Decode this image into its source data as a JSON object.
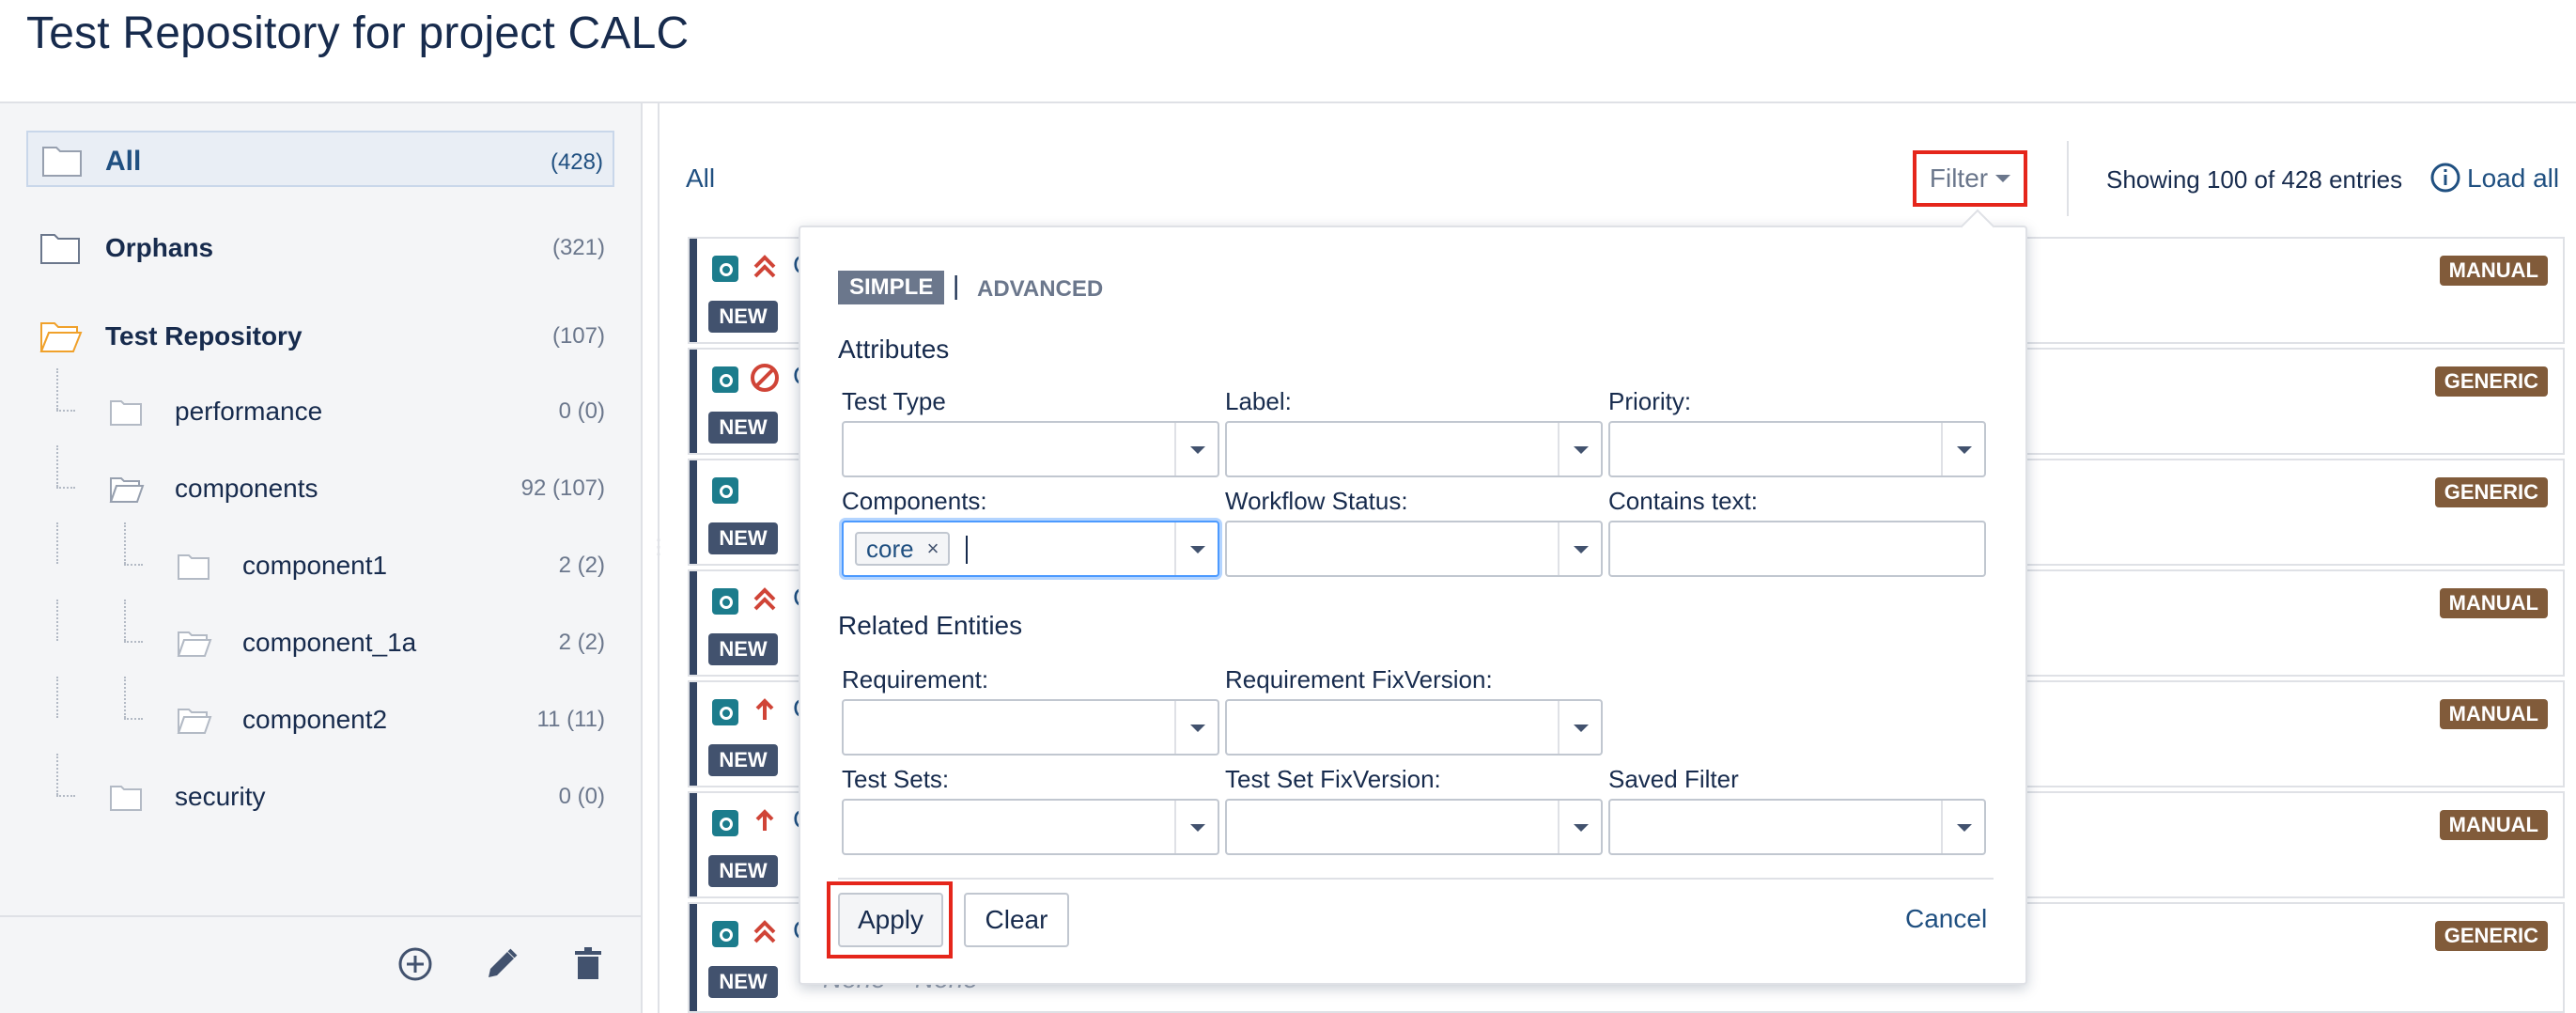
{
  "page": {
    "title": "Test Repository for project CALC"
  },
  "sidebar": {
    "all": {
      "label": "All",
      "count": "(428)"
    },
    "orphans": {
      "label": "Orphans",
      "count": "(321)"
    },
    "repo": {
      "label": "Test Repository",
      "count": "(107)"
    },
    "folders": [
      {
        "label": "performance",
        "count": "0 (0)"
      },
      {
        "label": "components",
        "count": "92 (107)"
      },
      {
        "label": "component1",
        "count": "2 (2)"
      },
      {
        "label": "component_1a",
        "count": "2 (2)"
      },
      {
        "label": "component2",
        "count": "11 (11)"
      },
      {
        "label": "security",
        "count": "0 (0)"
      }
    ],
    "tools": [
      "add-icon",
      "edit-icon",
      "delete-icon"
    ]
  },
  "main": {
    "crumb": "All",
    "filter_label": "Filter",
    "showing": "Showing 100 of 428 entries",
    "load_all": "Load all",
    "rows": [
      {
        "badge": "NEW",
        "type": "MANUAL",
        "priority": "double-chevron-up"
      },
      {
        "badge": "NEW",
        "type": "GENERIC",
        "priority": "blocked"
      },
      {
        "badge": "NEW",
        "type": "GENERIC",
        "priority": "none"
      },
      {
        "badge": "NEW",
        "type": "MANUAL",
        "priority": "double-chevron-up"
      },
      {
        "badge": "NEW",
        "type": "MANUAL",
        "priority": "arrow-up"
      },
      {
        "badge": "NEW",
        "type": "MANUAL",
        "priority": "arrow-up"
      },
      {
        "badge": "NEW",
        "type": "GENERIC",
        "priority": "double-chevron-up"
      }
    ],
    "trailing_text": "None    None"
  },
  "filter_panel": {
    "mode_simple": "SIMPLE",
    "mode_sep": "|",
    "mode_advanced": "ADVANCED",
    "attributes_title": "Attributes",
    "test_type_label": "Test Type",
    "label_label": "Label:",
    "priority_label": "Priority:",
    "components_label": "Components:",
    "components_chip": "core",
    "components_chip_remove": "×",
    "workflow_label": "Workflow Status:",
    "contains_label": "Contains text:",
    "related_title": "Related Entities",
    "requirement_label": "Requirement:",
    "req_fixversion_label": "Requirement FixVersion:",
    "test_sets_label": "Test Sets:",
    "ts_fixversion_label": "Test Set FixVersion:",
    "saved_filter_label": "Saved Filter",
    "apply": "Apply",
    "clear": "Clear",
    "cancel": "Cancel"
  },
  "colors": {
    "accent": "#205081",
    "highlight": "#e5261b",
    "type_badge": "#815b3a",
    "new_badge": "#42526e",
    "test_icon": "#1c7c8c"
  }
}
